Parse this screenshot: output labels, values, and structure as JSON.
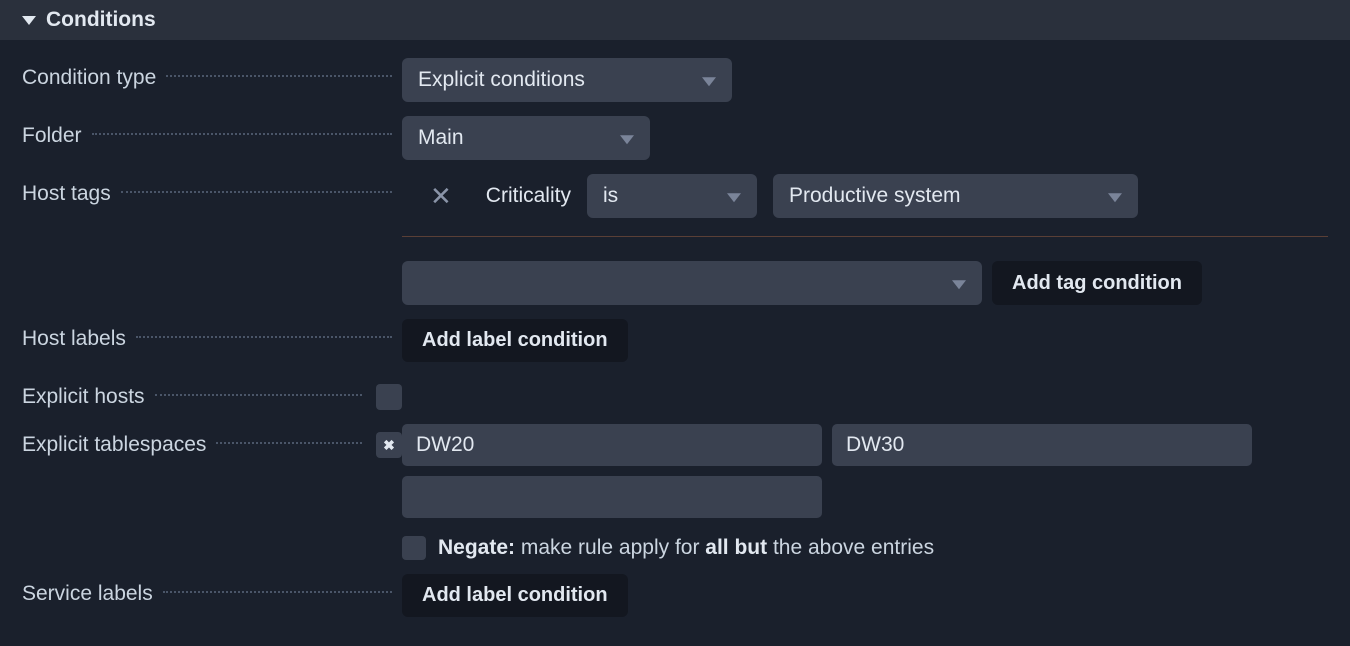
{
  "panel": {
    "title": "Conditions"
  },
  "rows": {
    "condition_type": {
      "label": "Condition type",
      "value": "Explicit conditions"
    },
    "folder": {
      "label": "Folder",
      "value": "Main"
    },
    "host_tags": {
      "label": "Host tags",
      "tag_group": "Criticality",
      "operator": "is",
      "value": "Productive system",
      "add_button": "Add tag condition"
    },
    "host_labels": {
      "label": "Host labels",
      "add_button": "Add label condition"
    },
    "explicit_hosts": {
      "label": "Explicit hosts"
    },
    "explicit_tablespaces": {
      "label": "Explicit tablespaces",
      "values": [
        "DW20",
        "DW30",
        ""
      ],
      "negate_label": "Negate:",
      "negate_mid": " make rule apply for ",
      "negate_bold": "all but",
      "negate_rest": " the above entries"
    },
    "service_labels": {
      "label": "Service labels",
      "add_button": "Add label condition"
    }
  }
}
